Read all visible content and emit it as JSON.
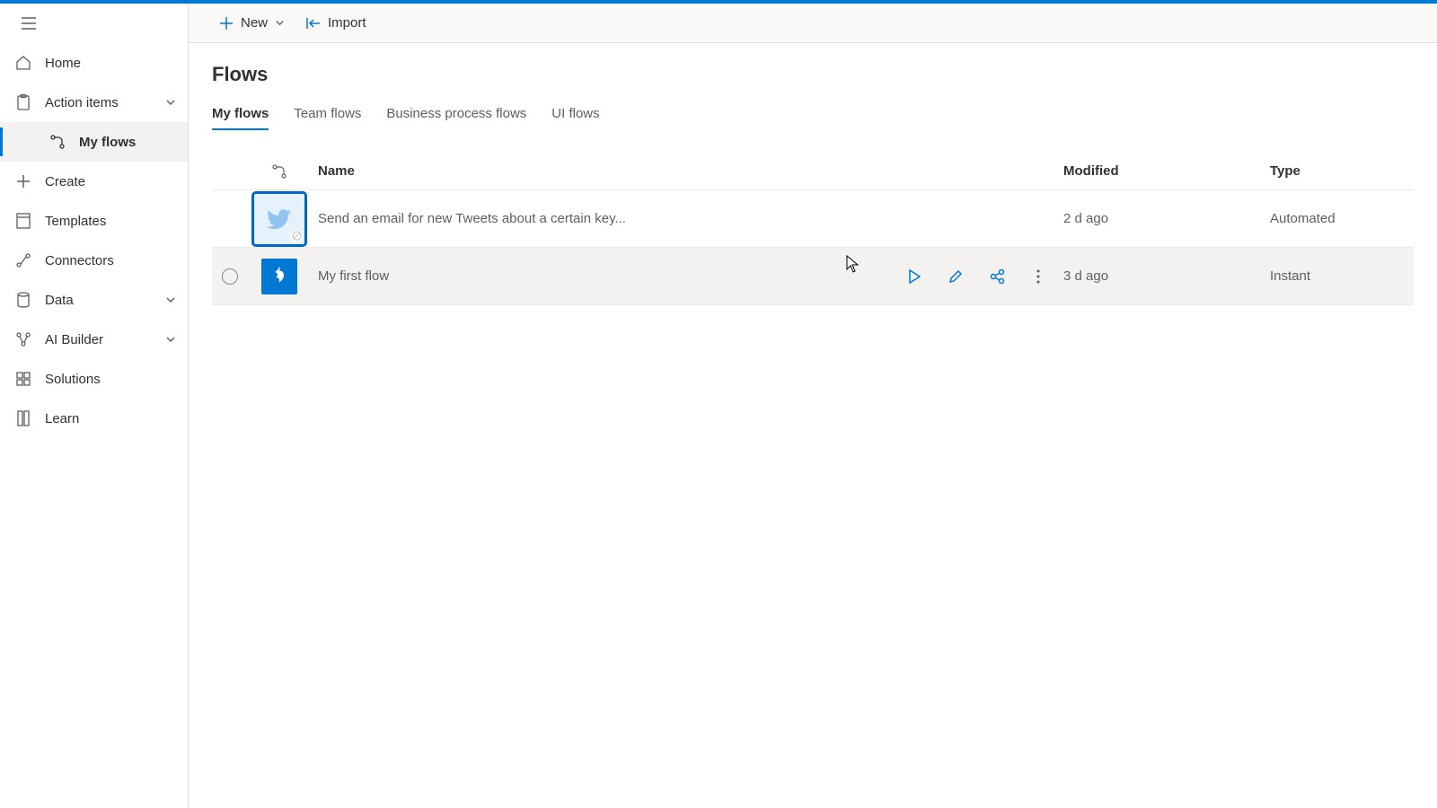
{
  "commandbar": {
    "new_label": "New",
    "import_label": "Import"
  },
  "sidebar": {
    "items": [
      {
        "label": "Home"
      },
      {
        "label": "Action items"
      },
      {
        "label": "My flows"
      },
      {
        "label": "Create"
      },
      {
        "label": "Templates"
      },
      {
        "label": "Connectors"
      },
      {
        "label": "Data"
      },
      {
        "label": "AI Builder"
      },
      {
        "label": "Solutions"
      },
      {
        "label": "Learn"
      }
    ]
  },
  "page": {
    "title": "Flows",
    "tabs": [
      {
        "label": "My flows"
      },
      {
        "label": "Team flows"
      },
      {
        "label": "Business process flows"
      },
      {
        "label": "UI flows"
      }
    ],
    "columns": {
      "name": "Name",
      "modified": "Modified",
      "type": "Type"
    },
    "rows": [
      {
        "name": "Send an email for new Tweets about a certain key...",
        "modified": "2 d ago",
        "type": "Automated"
      },
      {
        "name": "My first flow",
        "modified": "3 d ago",
        "type": "Instant"
      }
    ]
  }
}
